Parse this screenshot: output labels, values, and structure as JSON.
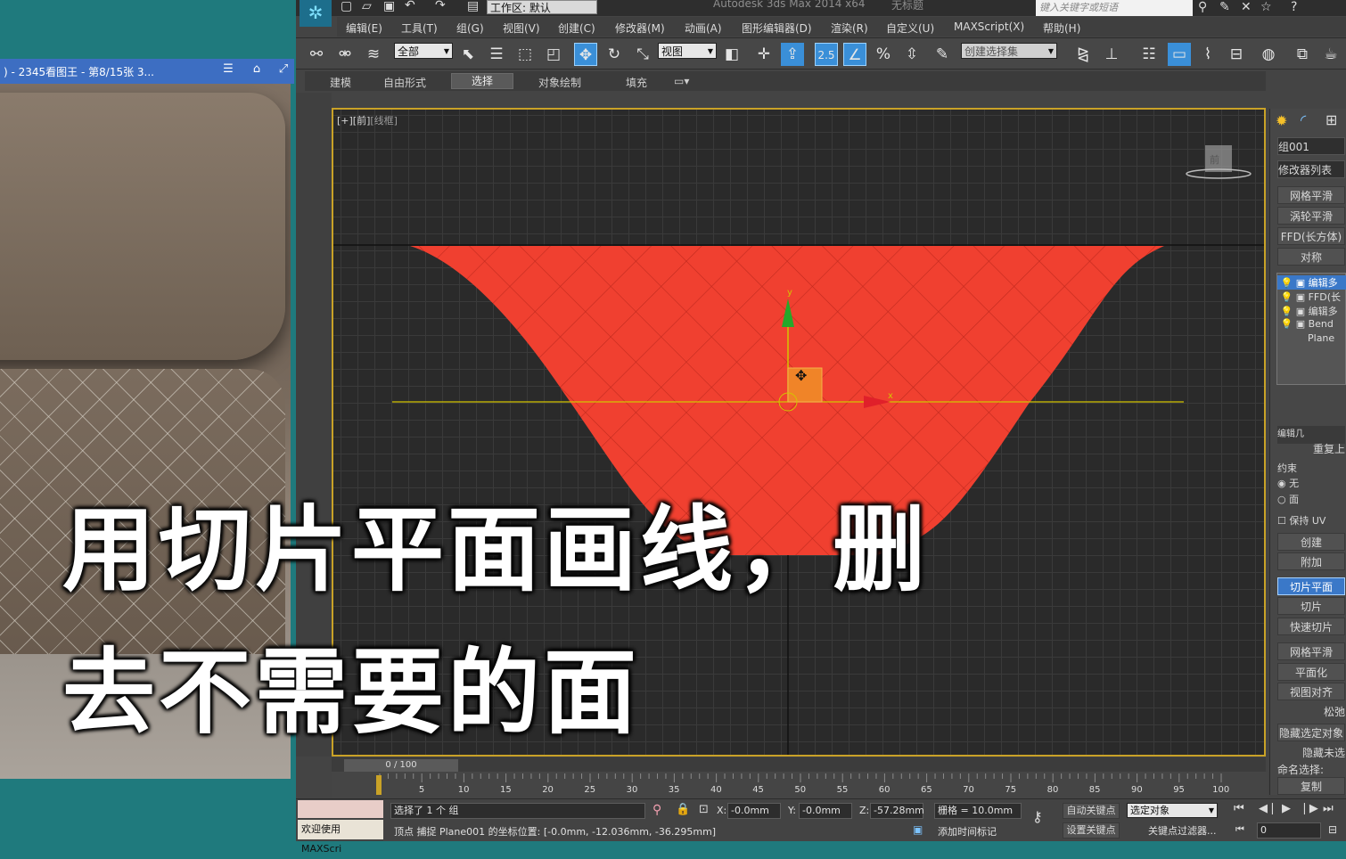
{
  "viewer": {
    "title": ") - 2345看图王 - 第8/15张 3..."
  },
  "app": {
    "title": "Autodesk 3ds Max  2014 x64",
    "doc_title": "无标题",
    "workspace": "工作区: 默认",
    "search_placeholder": "键入关键字或短语"
  },
  "menu": [
    "编辑(E)",
    "工具(T)",
    "组(G)",
    "视图(V)",
    "创建(C)",
    "修改器(M)",
    "动画(A)",
    "图形编辑器(D)",
    "渲染(R)",
    "自定义(U)",
    "MAXScript(X)",
    "帮助(H)"
  ],
  "toolbar": {
    "filter": "全部",
    "ref_coord": "视图",
    "selection_set": "创建选择集",
    "snap_value": "2.5"
  },
  "ribbon": {
    "tabs": [
      "建模",
      "自由形式",
      "选择",
      "对象绘制",
      "填充"
    ],
    "selected": "选择"
  },
  "viewport": {
    "label": "[+][前]",
    "label_mode": "[线框]",
    "viewcube": "前"
  },
  "command_panel": {
    "object_name": "组001",
    "modifier_list": "修改器列表",
    "buttons": [
      "网格平滑",
      "涡轮平滑",
      "FFD(长方体)",
      "对称"
    ],
    "stack": [
      "编辑多",
      "FFD(长",
      "编辑多",
      "Bend",
      "Plane"
    ],
    "rollout_title": "编辑几",
    "repeat": "重复上",
    "constraint_label": "约束",
    "constraint_none": "无",
    "constraint_face": "面",
    "preserve_uv": "保持 UV",
    "create": "创建",
    "attach": "附加",
    "slice_plane": "切片平面",
    "slice": "切片",
    "quickslice": "快速切片",
    "meshsmooth": "网格平滑",
    "planarize": "平面化",
    "view_align": "视图对齐",
    "relax": "松弛",
    "hide_selected": "隐藏选定对象",
    "hide_unselected": "隐藏未选",
    "named_sel": "命名选择:",
    "copy": "复制"
  },
  "timeline": {
    "slider": "0 / 100",
    "ticks": [
      "5",
      "10",
      "15",
      "20",
      "25",
      "30",
      "35",
      "40",
      "45",
      "50",
      "55",
      "60",
      "65",
      "70",
      "75",
      "80",
      "85",
      "90",
      "95",
      "100"
    ]
  },
  "status": {
    "welcome": "欢迎使用 MAXScri",
    "selected": "选择了 1 个 组",
    "prompt": "顶点 捕捉 Plane001 的坐标位置: [-0.0mm, -12.036mm, -36.295mm]",
    "x_label": "X:",
    "x": "-0.0mm",
    "y_label": "Y:",
    "y": "-0.0mm",
    "z_label": "Z:",
    "z": "-57.28mm",
    "grid": "栅格 = 10.0mm",
    "auto_key": "自动关键点",
    "set_key": "设置关键点",
    "key_mode": "选定对象",
    "key_filters": "关键点过滤器...",
    "add_time_tag": "添加时间标记",
    "frame": "0"
  },
  "subtitle": {
    "line1": "用切片平面画线，删",
    "line2": "去不需要的面"
  },
  "colors": {
    "mesh": "#f04030",
    "selection_blue": "#3a78c8",
    "viewport_border": "#c9a227"
  }
}
